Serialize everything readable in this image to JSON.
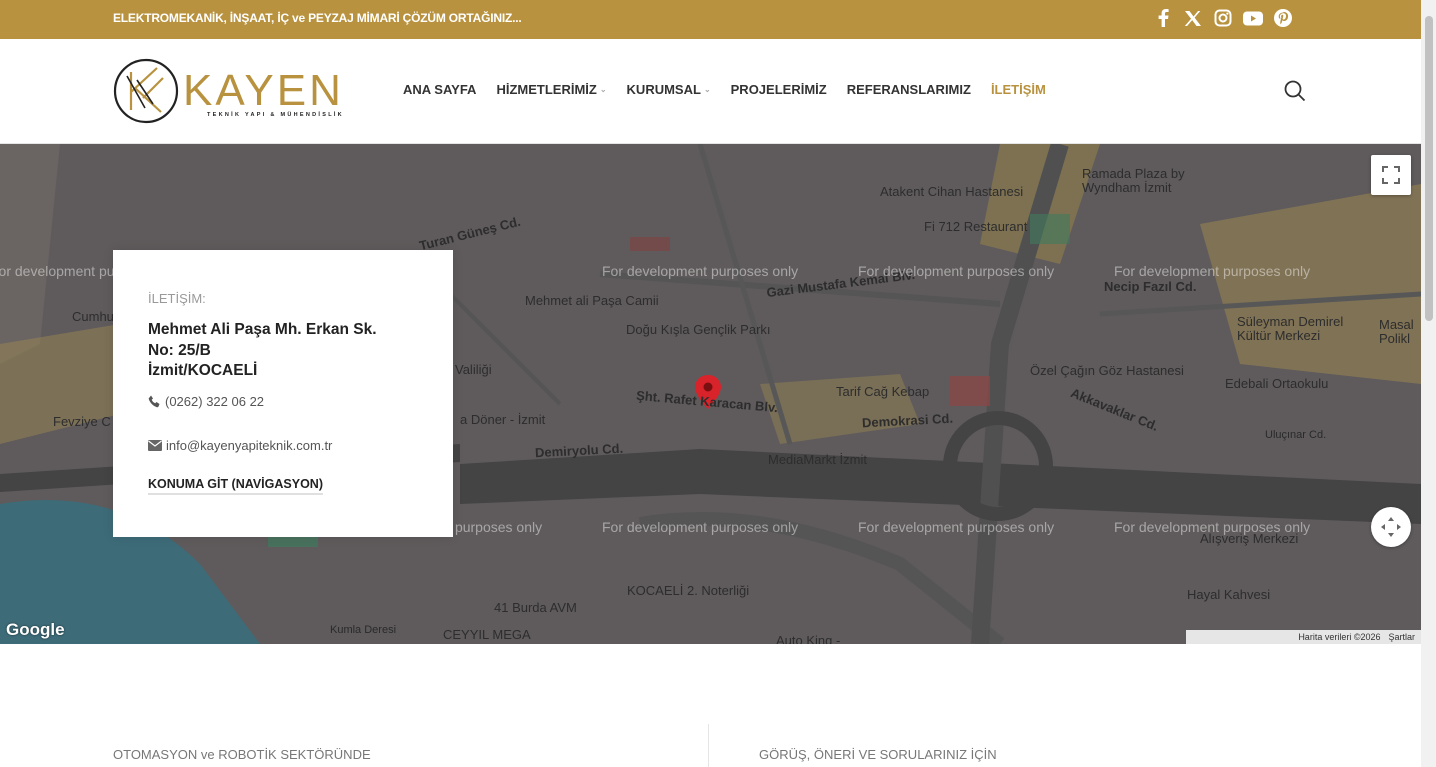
{
  "topbar": {
    "tagline": "ELEKTROMEKANİK, İNŞAAT, İÇ ve PEYZAJ MİMARİ ÇÖZÜM ORTAĞINIZ...",
    "social": [
      "facebook-icon",
      "x-icon",
      "instagram-icon",
      "youtube-icon",
      "pinterest-icon"
    ]
  },
  "logo": {
    "name": "KAYEN",
    "tagline": "TEKNİK YAPI & MÜHENDİSLİK"
  },
  "nav": {
    "items": [
      {
        "label": "ANA SAYFA",
        "has_dropdown": false,
        "active": false
      },
      {
        "label": "HİZMETLERİMİZ",
        "has_dropdown": true,
        "active": false
      },
      {
        "label": "KURUMSAL",
        "has_dropdown": true,
        "active": false
      },
      {
        "label": "PROJELERİMİZ",
        "has_dropdown": false,
        "active": false
      },
      {
        "label": "REFERANSLARIMIZ",
        "has_dropdown": false,
        "active": false
      },
      {
        "label": "İLETİŞİM",
        "has_dropdown": false,
        "active": true
      }
    ]
  },
  "map": {
    "dev_text": "For development purposes only",
    "google": "Google",
    "attribution": "Harita verileri ©2026",
    "terms": "Şartlar",
    "pois": {
      "ramada": "Ramada Plaza by",
      "ramada2": "Wyndham İzmit",
      "atakent": "Atakent Cihan Hastanesi",
      "fi712": "Fi 712 Restaurant",
      "camii": "Mehmet ali Paşa Camii",
      "park": "Doğu Kışla Gençlik Parkı",
      "suleyman": "Süleyman Demirel",
      "suleyman2": "Kültür Merkezi",
      "ozel": "Özel Çağın Göz Hastanesi",
      "tarif": "Tarif Cağ Kebap",
      "edebali": "Edebali Ortaokulu",
      "mediamarkt": "MediaMarkt İzmit",
      "noterligi": "KOCAELİ 2. Noterliği",
      "burda": "41 Burda AVM",
      "ceyyil": "CEYYIL MEGA",
      "autoking": "Auto King -",
      "hayal": "Hayal Kahvesi",
      "alisveris": "Alışveriş Merkezi",
      "necip": "Necip Fazıl Cd.",
      "gazi": "Gazi Mustafa Kemal Blv.",
      "demokrasi": "Demokrasi Cd.",
      "demiryolu": "Demiryolu Cd.",
      "akkavaklar": "Akkavaklar Cd.",
      "rafet": "Şht. Rafet Karacan Blv.",
      "turan": "Turan Güneş Cd.",
      "doner": "a Döner - İzmit",
      "yaliligi": "Valiliği",
      "fevziye": "Fevziye C",
      "cumhur": "Cumhu",
      "masal": "Masal",
      "polikl": "Polikl",
      "ulucinar": "Uluçınar Cd.",
      "kumla": "Kumla Deresi"
    }
  },
  "card": {
    "label": "İLETİŞİM:",
    "address_line1": "Mehmet Ali Paşa Mh. Erkan Sk.",
    "address_line2": "No: 25/B",
    "address_line3": "İzmit/KOCAELİ",
    "phone": "(0262) 322 06 22",
    "email": "info@kayenyapiteknik.com.tr",
    "nav_link": "KONUMA GİT (NAVİGASYON)"
  },
  "bottom": {
    "left": "OTOMASYON ve ROBOTİK SEKTÖRÜNDE",
    "right": "GÖRÜŞ, ÖNERİ VE SORULARINIZ İÇİN"
  },
  "colors": {
    "accent": "#b8923e",
    "map_bg": "#5f5b5c",
    "pin": "#d8232a"
  }
}
